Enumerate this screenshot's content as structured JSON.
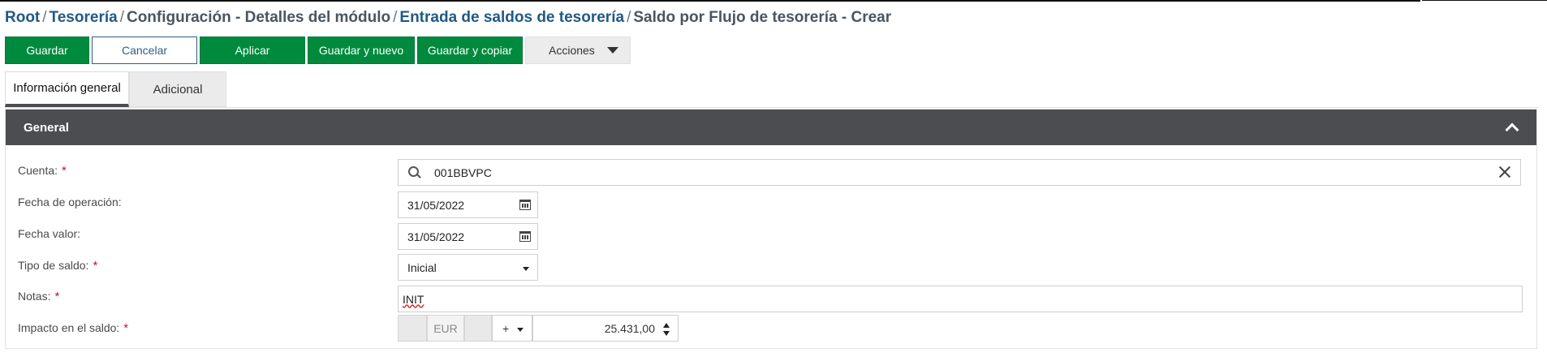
{
  "breadcrumb": {
    "root": "Root",
    "tesoreria": "Tesorería",
    "configuracion": "Configuración - Detalles del módulo",
    "entrada": "Entrada de saldos de tesorería",
    "current": "Saldo por Flujo de tesorería - Crear",
    "separator": "/"
  },
  "toolbar": {
    "guardar": "Guardar",
    "cancelar": "Cancelar",
    "aplicar": "Aplicar",
    "guardar_nuevo": "Guardar y nuevo",
    "guardar_copiar": "Guardar y copiar",
    "acciones": "Acciones"
  },
  "tabs": [
    {
      "label": "Información general",
      "active": true
    },
    {
      "label": "Adicional",
      "active": false
    }
  ],
  "section": {
    "title": "General"
  },
  "form": {
    "cuenta": {
      "label": "Cuenta:",
      "required": "*",
      "value": "001BBVPC",
      "icon": "search-icon"
    },
    "fecha_operacion": {
      "label": "Fecha de operación:",
      "value": "31/05/2022",
      "icon": "calendar-icon"
    },
    "fecha_valor": {
      "label": "Fecha valor:",
      "value": "31/05/2022",
      "icon": "calendar-icon"
    },
    "tipo_saldo": {
      "label": "Tipo de saldo:",
      "required": "*",
      "value": "Inicial"
    },
    "notas": {
      "label": "Notas:",
      "required": "*",
      "value": "INIT"
    },
    "impacto": {
      "label": "Impacto en el saldo:",
      "required": "*",
      "currency": "EUR",
      "sign": "+",
      "amount": "25.431,00"
    }
  },
  "colors": {
    "primary_green": "#008a3e",
    "link_blue": "#1f5a84",
    "header_dark": "#4b4d50",
    "required_red": "#c0143c"
  }
}
